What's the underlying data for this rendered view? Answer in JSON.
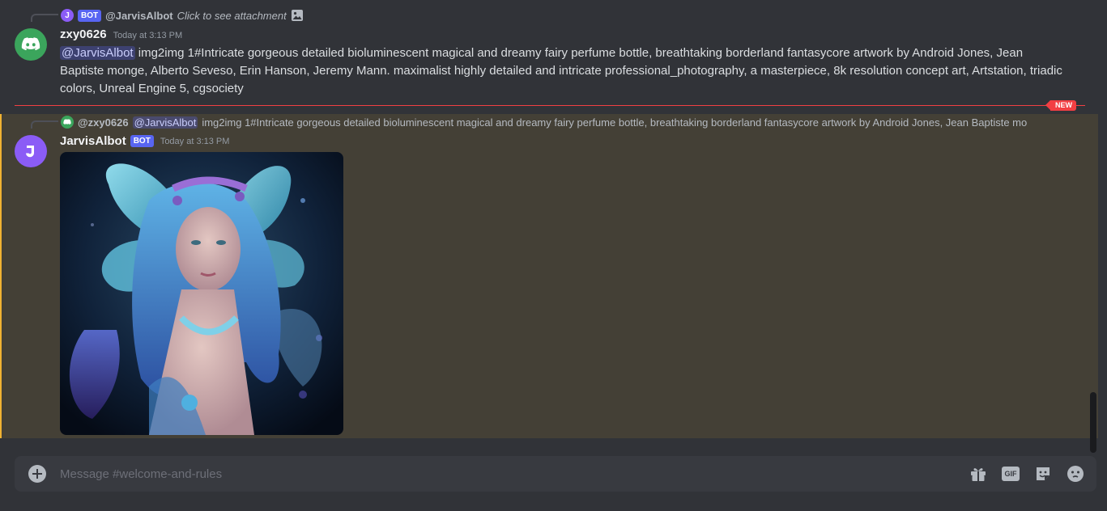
{
  "messages": [
    {
      "reply": {
        "bot_tag": "BOT",
        "mention": "@JarvisAlbot",
        "attachment_text": "Click to see attachment",
        "icon": "image-icon"
      },
      "author": "zxy0626",
      "timestamp": "Today at 3:13 PM",
      "mention": "@JarvisAlbot",
      "text": " img2img 1#Intricate gorgeous detailed bioluminescent magical and dreamy fairy perfume bottle, breathtaking borderland fantasycore artwork by Android Jones, Jean Baptiste monge, Alberto Seveso, Erin Hanson, Jeremy Mann. maximalist highly detailed and intricate professional_photography, a masterpiece, 8k resolution concept art, Artstation, triadic colors, Unreal Engine 5, cgsociety",
      "avatar_icon": "discord-logo-icon",
      "avatar_color": "#3ba55c"
    },
    {
      "reply": {
        "author": "@zxy0626",
        "mention": "@JarvisAlbot",
        "text": "img2img 1#Intricate gorgeous detailed bioluminescent magical and dreamy fairy perfume bottle, breathtaking borderland fantasycore artwork by Android Jones, Jean Baptiste mo"
      },
      "author": "JarvisAlbot",
      "bot_tag": "BOT",
      "timestamp": "Today at 3:13 PM",
      "avatar_icon": "j-logo-icon",
      "avatar_color": "#8b5cf6",
      "attachment_name": "fairy-attachment-image"
    }
  ],
  "divider": {
    "label": "NEW",
    "color": "#f23f43"
  },
  "composer": {
    "placeholder": "Message #welcome-and-rules",
    "gif_label": "GIF"
  }
}
